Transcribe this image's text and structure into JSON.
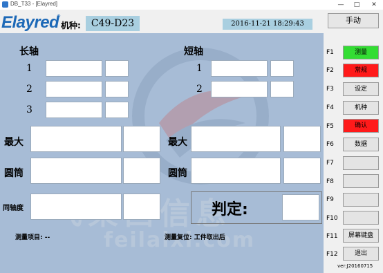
{
  "window": {
    "title": "DB_T33 - [Elayred]"
  },
  "header": {
    "logo": "Elayred",
    "model_label": "机种:",
    "model_value": "C49-D23",
    "datetime": "2016-11-21  18:29:43",
    "manual_button": "手动"
  },
  "main": {
    "long_axis": {
      "title": "长轴",
      "rows": [
        "1",
        "2",
        "3"
      ]
    },
    "short_axis": {
      "title": "短轴",
      "rows": [
        "1",
        "2"
      ]
    },
    "left": {
      "max_label": "最大",
      "cyl_label": "圆筒",
      "coax_label": "同轴度"
    },
    "right": {
      "max_label": "最大",
      "cyl_label": "圆筒"
    },
    "judge_label": "判定:",
    "measure_item_label": "测量项目: --",
    "measure_reset_label": "测量复位:  工件取出后"
  },
  "fkeys": [
    {
      "key": "F1",
      "label": "测量",
      "color": "green"
    },
    {
      "key": "F2",
      "label": "常规",
      "color": "red"
    },
    {
      "key": "F3",
      "label": "设定",
      "color": ""
    },
    {
      "key": "F4",
      "label": "机种",
      "color": ""
    },
    {
      "key": "F5",
      "label": "确认",
      "color": "red"
    },
    {
      "key": "F6",
      "label": "数据",
      "color": ""
    },
    {
      "key": "F7",
      "label": "",
      "color": ""
    },
    {
      "key": "F8",
      "label": "",
      "color": ""
    },
    {
      "key": "F9",
      "label": "",
      "color": ""
    },
    {
      "key": "F10",
      "label": "",
      "color": ""
    },
    {
      "key": "F11",
      "label": "屏幕键盘",
      "color": ""
    },
    {
      "key": "F12",
      "label": "退出",
      "color": ""
    }
  ],
  "version": "ver:J20160715",
  "watermark": {
    "text": "飞莱西信息",
    "sub": "feilaixi.com"
  },
  "colors": {
    "panel": "#a7bcd6",
    "field_bg": "#a9cfe0",
    "brand": "#1d69b7",
    "green": "#33dd33",
    "red": "#ff1a1a"
  }
}
